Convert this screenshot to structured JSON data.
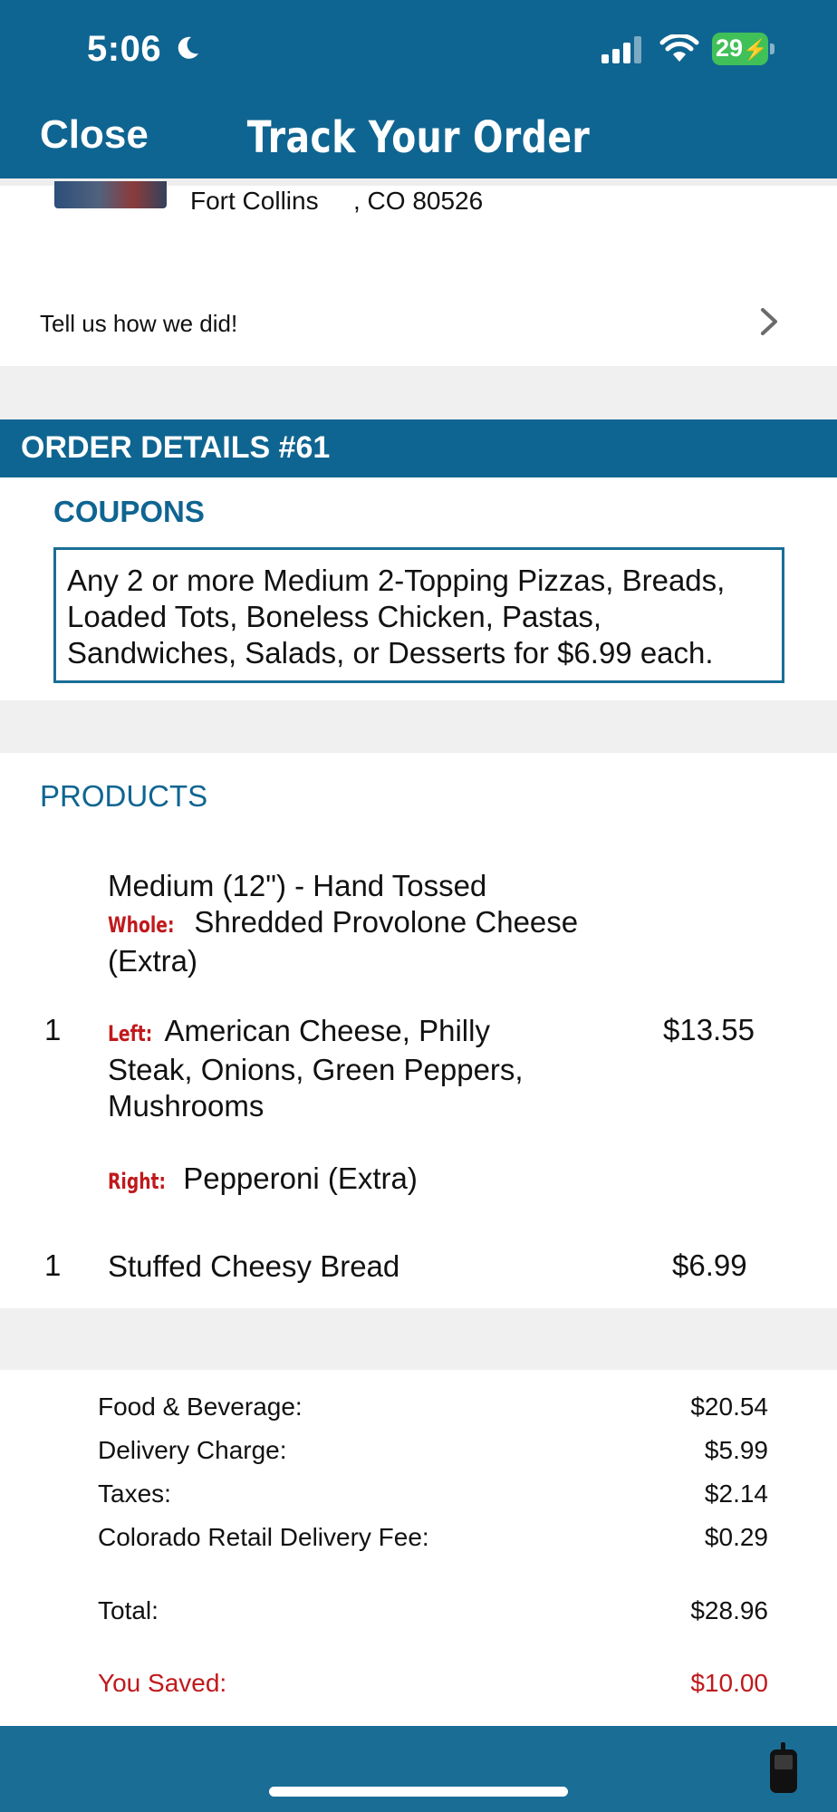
{
  "status_bar": {
    "time": "5:06",
    "battery": "29",
    "icons": [
      "moon-icon",
      "signal-icon",
      "wifi-icon",
      "battery-icon"
    ]
  },
  "nav": {
    "close_label": "Close",
    "title": "Track Your Order"
  },
  "store": {
    "city": "Fort Collins",
    "state_zip": ", CO 80526"
  },
  "feedback": {
    "label": "Tell us how we did!"
  },
  "order": {
    "title": "ORDER DETAILS #61",
    "coupons_heading": "COUPONS",
    "coupon_text": "Any 2 or more Medium 2-Topping Pizzas, Breads, Loaded Tots, Boneless Chicken, Pastas, Sandwiches, Salads, or Desserts for $6.99 each."
  },
  "products": {
    "heading": "PRODUCTS",
    "items": [
      {
        "qty": "1",
        "name": "Medium (12\") - Hand Tossed",
        "whole_tag": "Whole:",
        "whole_text": "Shredded Provolone Cheese (Extra)",
        "left_tag": "Left:",
        "left_text": "American Cheese, Philly Steak, Onions, Green Peppers, Mushrooms",
        "right_tag": "Right:",
        "right_text": "Pepperoni (Extra)",
        "price": "$13.55"
      },
      {
        "qty": "1",
        "name": "Stuffed Cheesy Bread",
        "price": "$6.99"
      }
    ]
  },
  "totals": {
    "food_label": "Food & Beverage:",
    "food_value": "$20.54",
    "delivery_label": "Delivery Charge:",
    "delivery_value": "$5.99",
    "taxes_label": "Taxes:",
    "taxes_value": "$2.14",
    "fee_label": "Colorado Retail Delivery Fee:",
    "fee_value": "$0.29",
    "total_label": "Total:",
    "total_value": "$28.96",
    "saved_label": "You Saved:",
    "saved_value": "$10.00"
  },
  "colors": {
    "brand_blue": "#0f6591",
    "accent_red": "#c0191c",
    "battery_green": "#40c058"
  }
}
